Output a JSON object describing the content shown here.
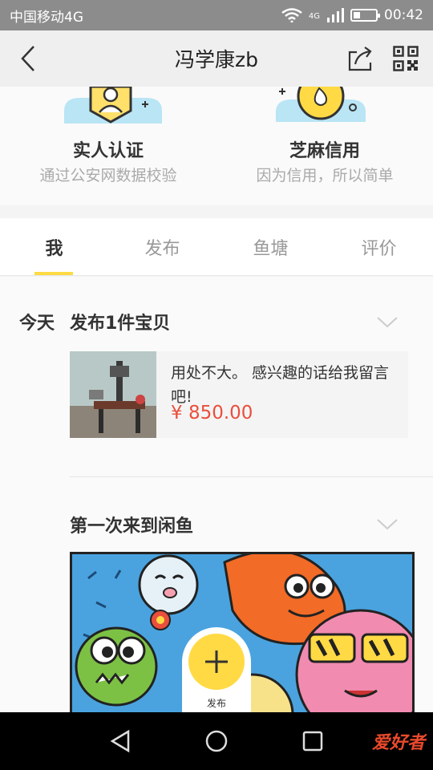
{
  "status_bar": {
    "carrier": "中国移动4G",
    "network": "4G",
    "time": "00:42"
  },
  "nav": {
    "title": "冯学康zb"
  },
  "certifications": [
    {
      "title": "实人认证",
      "subtitle": "通过公安网数据校验"
    },
    {
      "title": "芝麻信用",
      "subtitle": "因为信用，所以简单"
    }
  ],
  "tabs": [
    {
      "label": "我",
      "active": true
    },
    {
      "label": "发布",
      "active": false
    },
    {
      "label": "鱼塘",
      "active": false
    },
    {
      "label": "评价",
      "active": false
    }
  ],
  "feed": {
    "day_label": "今天",
    "publish_title": "发布1件宝贝",
    "item": {
      "description": "用处不大。 感兴趣的话给我留言吧!",
      "price": "¥ 850.00"
    },
    "first_visit_title": "第一次来到闲鱼"
  },
  "fab": {
    "label": "发布"
  },
  "watermark": "爱好者",
  "colors": {
    "accent": "#ffda44",
    "price": "#e94f3c"
  }
}
